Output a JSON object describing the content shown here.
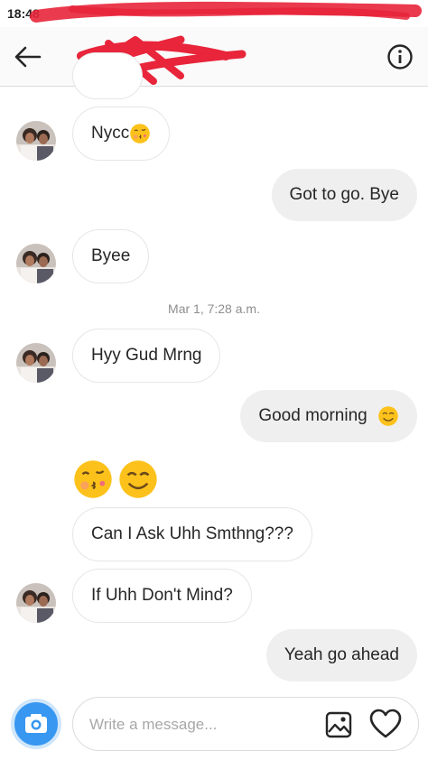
{
  "status_bar": {
    "time": "18:48"
  },
  "header": {
    "title": "",
    "back_icon": "arrow-left-icon",
    "info_icon": "info-circle-icon"
  },
  "messages": [
    {
      "id": "m1",
      "side": "in",
      "text": "Nycc",
      "emoji": "kissing-face"
    },
    {
      "id": "m2",
      "side": "out",
      "text": "Got to go. Bye"
    },
    {
      "id": "m3",
      "side": "in",
      "text": "Byee"
    },
    {
      "id": "m5",
      "side": "in",
      "text": "Hyy Gud Mrng"
    },
    {
      "id": "m6",
      "side": "out",
      "text": "Good morning",
      "emoji": "smiling-face"
    },
    {
      "id": "m7",
      "side": "in",
      "emojis": [
        "kissing-face",
        "smiling-face"
      ]
    },
    {
      "id": "m8",
      "side": "in",
      "text": "Can I Ask Uhh Smthng???"
    },
    {
      "id": "m9",
      "side": "in",
      "text": "If Uhh Don't Mind?"
    },
    {
      "id": "m10",
      "side": "out",
      "text": "Yeah go ahead"
    }
  ],
  "timestamp": "Mar 1, 7:28 a.m.",
  "composer": {
    "placeholder": "Write a message...",
    "camera_icon": "camera-icon",
    "gallery_icon": "gallery-icon",
    "heart_icon": "heart-icon"
  },
  "colors": {
    "accent": "#3897f0",
    "incoming_border": "#e6e6e6",
    "outgoing_bg": "#efefef",
    "redaction": "#e8253a",
    "emoji": "#f7c21c"
  }
}
